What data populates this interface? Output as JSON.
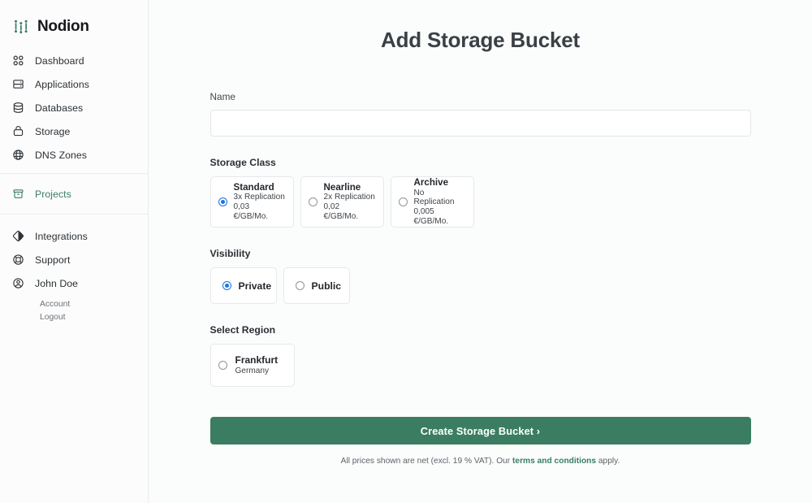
{
  "brand": {
    "name": "Nodion",
    "logo_icon": "nodion-logo-icon"
  },
  "sidebar": {
    "primary": [
      {
        "label": "Dashboard",
        "icon": "grid-dots-icon"
      },
      {
        "label": "Applications",
        "icon": "server-stack-icon"
      },
      {
        "label": "Databases",
        "icon": "database-icon"
      },
      {
        "label": "Storage",
        "icon": "storage-bucket-icon"
      },
      {
        "label": "DNS Zones",
        "icon": "globe-icon"
      }
    ],
    "projects": {
      "label": "Projects",
      "icon": "archive-box-icon",
      "accent_color": "#3a7d63"
    },
    "secondary": [
      {
        "label": "Integrations",
        "icon": "integrations-diamond-icon"
      },
      {
        "label": "Support",
        "icon": "lifebuoy-icon"
      }
    ],
    "user": {
      "name": "John Doe",
      "icon": "user-circle-icon",
      "links": [
        {
          "label": "Account"
        },
        {
          "label": "Logout"
        }
      ]
    }
  },
  "main": {
    "title": "Add Storage Bucket",
    "name_field": {
      "label": "Name",
      "value": "",
      "placeholder": ""
    },
    "storage_class": {
      "label": "Storage Class",
      "options": [
        {
          "title": "Standard",
          "replication": "3x Replication",
          "price": "0,03 €/GB/Mo.",
          "selected": true
        },
        {
          "title": "Nearline",
          "replication": "2x Replication",
          "price": "0,02 €/GB/Mo.",
          "selected": false
        },
        {
          "title": "Archive",
          "replication": "No Replication",
          "price": "0,005 €/GB/Mo.",
          "selected": false
        }
      ]
    },
    "visibility": {
      "label": "Visibility",
      "options": [
        {
          "title": "Private",
          "selected": true
        },
        {
          "title": "Public",
          "selected": false
        }
      ]
    },
    "region": {
      "label": "Select Region",
      "options": [
        {
          "title": "Frankfurt",
          "country": "Germany",
          "selected": false
        }
      ]
    },
    "submit": {
      "label": "Create Storage Bucket ›",
      "color": "#3a7d63"
    },
    "fineprint": {
      "before": "All prices shown are net (excl. 19 % VAT). Our ",
      "link": "terms and conditions",
      "after": " apply."
    }
  }
}
